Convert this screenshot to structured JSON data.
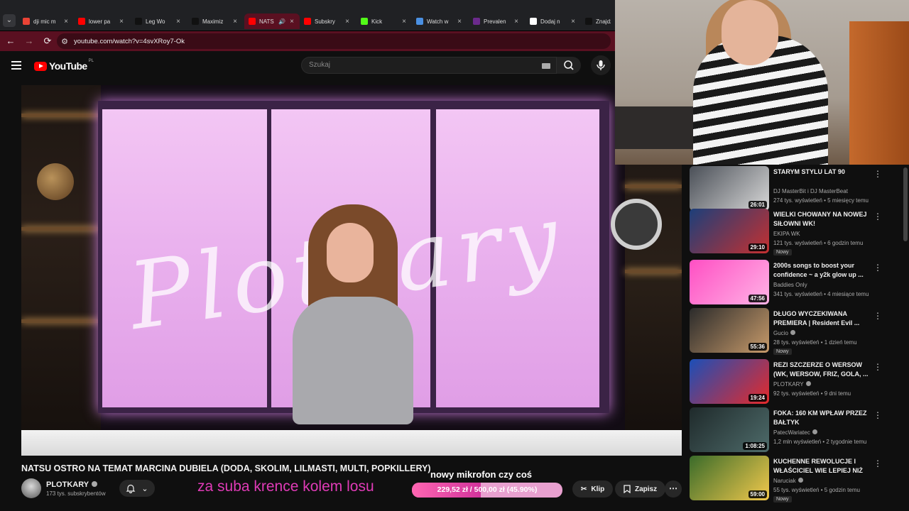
{
  "browser": {
    "tabs": [
      {
        "title": "dji mic m",
        "color": "#ea4335",
        "active": false,
        "speaker": false
      },
      {
        "title": "lower pa",
        "color": "#ff0000",
        "active": false,
        "speaker": false
      },
      {
        "title": "Leg Wo",
        "color": "#111111",
        "active": false,
        "speaker": false
      },
      {
        "title": "Maximiz",
        "color": "#111111",
        "active": false,
        "speaker": false
      },
      {
        "title": "NATS",
        "color": "#ff0000",
        "active": true,
        "speaker": true
      },
      {
        "title": "Subskry",
        "color": "#ff0000",
        "active": false,
        "speaker": false
      },
      {
        "title": "Kick",
        "color": "#53fc18",
        "active": false,
        "speaker": false
      },
      {
        "title": "Watch w",
        "color": "#4a90e2",
        "active": false,
        "speaker": false
      },
      {
        "title": "Prevalen",
        "color": "#6b2a8c",
        "active": false,
        "speaker": false
      },
      {
        "title": "Dodaj n",
        "color": "#ffffff",
        "active": false,
        "speaker": false
      },
      {
        "title": "Znajdź",
        "color": "#111111",
        "active": false,
        "speaker": false
      }
    ],
    "url": "youtube.com/watch?v=4svXRoy7-Ok"
  },
  "header": {
    "logo_text": "YouTube",
    "country_code": "PL",
    "search_placeholder": "Szukaj"
  },
  "video": {
    "title": "NATSU OSTRO NA TEMAT MARCINA DUBIELA (DODA, SKOLIM, LILMASTI, MULTI, POPKILLERY)",
    "watermark": "Plotkary",
    "overlay_text": "nowy mikrofon czy coś",
    "channel": {
      "name": "PLOTKARY",
      "subscribers": "173 tys. subskrybentów"
    },
    "promo_text": "za suba krence kolem losu",
    "donation": {
      "label": "229,52 zł / 500,00 zł (45.90%)",
      "progress_percent": 45.9
    },
    "actions": {
      "clip": "Klip",
      "save": "Zapisz"
    }
  },
  "sidebar": {
    "items": [
      {
        "title": "STARYM STYLU LAT 90",
        "channel": "DJ MasterBit i DJ MasterBeat",
        "verified": false,
        "meta": "274 tys. wyświetleń • 5 miesięcy temu",
        "duration": "26:01",
        "badge": "",
        "thumb_colors": [
          "#4a4f57",
          "#d8d8d8"
        ]
      },
      {
        "title": "WIELKI CHOWANY NA NOWEJ SIŁOWNI WK!",
        "channel": "EKIPA WK",
        "verified": false,
        "meta": "121 tys. wyświetleń • 6 godzin temu",
        "duration": "29:10",
        "badge": "Nowy",
        "thumb_colors": [
          "#1c3f7a",
          "#c53030"
        ]
      },
      {
        "title": "2000s songs to boost your confidence ~ a y2k glow up ...",
        "channel": "Baddies Only",
        "verified": false,
        "meta": "341 tys. wyświetleń • 4 miesiące temu",
        "duration": "47:56",
        "badge": "",
        "thumb_colors": [
          "#ff4fc3",
          "#ffb3e6"
        ]
      },
      {
        "title": "DŁUGO WYCZEKIWANA PREMIERA | Resident Evil ...",
        "channel": "Gucio",
        "verified": true,
        "meta": "28 tys. wyświetleń • 1 dzień temu",
        "duration": "55:36",
        "badge": "Nowy",
        "thumb_colors": [
          "#2b2b2b",
          "#c79a6a"
        ]
      },
      {
        "title": "REZI SZCZERZE O WERSOW (WK, WERSOW, FRIZ, GOLA, ...",
        "channel": "PLOTKARY",
        "verified": true,
        "meta": "92 tys. wyświetleń • 9 dni temu",
        "duration": "19:24",
        "badge": "",
        "thumb_colors": [
          "#1b4fb8",
          "#e62a2a"
        ]
      },
      {
        "title": "FOKA: 160 KM WPŁAW PRZEZ BAŁTYK",
        "channel": "PatecWariatec",
        "verified": true,
        "meta": "1,2 mln wyświetleń • 2 tygodnie temu",
        "duration": "1:08:25",
        "badge": "",
        "thumb_colors": [
          "#1f2a2b",
          "#4e6b6a"
        ]
      },
      {
        "title": "KUCHENNE REWOLUCJE I WŁAŚCICIEL WIE LEPIEJ NIŻ ...",
        "channel": "Naruciak",
        "verified": true,
        "meta": "55 tys. wyświetleń • 5 godzin temu",
        "duration": "59:00",
        "badge": "Nowy",
        "thumb_colors": [
          "#3a6b2a",
          "#f2c94c"
        ]
      }
    ]
  }
}
